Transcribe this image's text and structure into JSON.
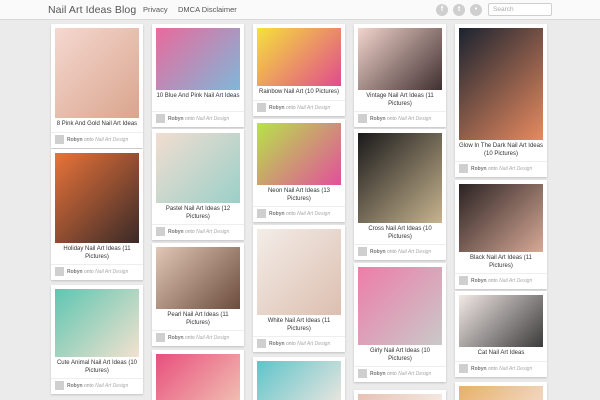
{
  "header": {
    "brand": "Nail Art Ideas Blog",
    "nav": [
      "Privacy",
      "DMCA Disclaimer"
    ],
    "social_icons": [
      "facebook-icon",
      "twitter-icon",
      "rss-icon"
    ],
    "search_placeholder": "Search"
  },
  "pins": [
    {
      "title": "8 Pink And Gold Nail Art Ideas",
      "author": "Robyn",
      "joiner": "onto",
      "board": "Nail Art Design",
      "colors": [
        "#f5d8d0",
        "#d9a58d"
      ]
    },
    {
      "title": "Holiday Nail Art Ideas (11 Pictures)",
      "author": "Robyn",
      "joiner": "onto",
      "board": "Nail Art Design",
      "colors": [
        "#e9733a",
        "#3a2a28"
      ]
    },
    {
      "title": "Cute Animal Nail Art Ideas (10 Pictures)",
      "author": "Robyn",
      "joiner": "onto",
      "board": "Nail Art Design",
      "colors": [
        "#5ec6b1",
        "#f2e2cf"
      ]
    },
    {
      "title": "10 Blue And Pink Nail Art Ideas",
      "author": "Robyn",
      "joiner": "onto",
      "board": "Nail Art Design",
      "colors": [
        "#e96a9c",
        "#7fb7d9"
      ]
    },
    {
      "title": "Pastel Nail Art Ideas (12 Pictures)",
      "author": "Robyn",
      "joiner": "onto",
      "board": "Nail Art Design",
      "colors": [
        "#f2ddd0",
        "#9ad0c8"
      ]
    },
    {
      "title": "Pearl Nail Art Ideas (11 Pictures)",
      "author": "Robyn",
      "joiner": "onto",
      "board": "Nail Art Design",
      "colors": [
        "#e2c7b5",
        "#6b4c3d"
      ]
    },
    {
      "title": "",
      "author": "",
      "joiner": "",
      "board": "",
      "colors": [
        "#e84f7e",
        "#f2c9b6"
      ]
    },
    {
      "title": "Rainbow Nail Art (10 Pictures)",
      "author": "Robyn",
      "joiner": "onto",
      "board": "Nail Art Design",
      "colors": [
        "#f6e13a",
        "#e14b8d"
      ]
    },
    {
      "title": "Neon Nail Art Ideas (13 Pictures)",
      "author": "Robyn",
      "joiner": "onto",
      "board": "Nail Art Design",
      "colors": [
        "#b7e34a",
        "#e24f9b"
      ]
    },
    {
      "title": "White Nail Art Ideas (11 Pictures)",
      "author": "Robyn",
      "joiner": "onto",
      "board": "Nail Art Design",
      "colors": [
        "#f3ede8",
        "#dcbfb0"
      ]
    },
    {
      "title": "",
      "author": "",
      "joiner": "",
      "board": "",
      "colors": [
        "#5fc4c9",
        "#f0e7e0"
      ]
    },
    {
      "title": "Vintage Nail Art Ideas (11 Pictures)",
      "author": "Robyn",
      "joiner": "onto",
      "board": "Nail Art Design",
      "colors": [
        "#f2d4cc",
        "#403030"
      ]
    },
    {
      "title": "Cross Nail Art Ideas (10 Pictures)",
      "author": "Robyn",
      "joiner": "onto",
      "board": "Nail Art Design",
      "colors": [
        "#1a1a1a",
        "#c7b48f"
      ]
    },
    {
      "title": "Girly Nail Art Ideas (10 Pictures)",
      "author": "Robyn",
      "joiner": "onto",
      "board": "Nail Art Design",
      "colors": [
        "#ee7da8",
        "#c9c9c9"
      ]
    },
    {
      "title": "",
      "author": "",
      "joiner": "",
      "board": "",
      "colors": [
        "#e7c1b2",
        "#f6eee9"
      ]
    },
    {
      "title": "Glow In The Dark Nail Art Ideas (10 Pictures)",
      "author": "Robyn",
      "joiner": "onto",
      "board": "Nail Art Design",
      "colors": [
        "#1b2330",
        "#e78a5e"
      ]
    },
    {
      "title": "Black Nail Art Ideas (11 Pictures)",
      "author": "Robyn",
      "joiner": "onto",
      "board": "Nail Art Design",
      "colors": [
        "#2a2222",
        "#d7a996"
      ]
    },
    {
      "title": "Cat Nail Art Ideas",
      "author": "Robyn",
      "joiner": "onto",
      "board": "Nail Art Design",
      "colors": [
        "#f2e9e6",
        "#3b3b3b"
      ]
    },
    {
      "title": "",
      "author": "",
      "joiner": "",
      "board": "",
      "colors": [
        "#e8b06a",
        "#f2d9c4"
      ]
    }
  ]
}
